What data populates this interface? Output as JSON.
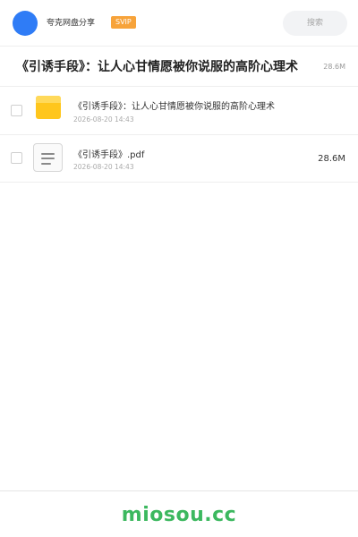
{
  "header": {
    "site_name": "夸克网盘分享",
    "badge": "SVIP",
    "search_placeholder": "搜索"
  },
  "share": {
    "title": "《引诱手段》：让人心甘情愿被你说服的高阶心理术",
    "total_size": "28.6M"
  },
  "files": [
    {
      "type": "folder",
      "icon": "folder-icon",
      "name": "《引诱手段》：让人心甘情愿被你说服的高阶心理术",
      "date": "2026-08-20 14:43",
      "size": ""
    },
    {
      "type": "pdf",
      "icon": "document-icon",
      "name": "《引诱手段》.pdf",
      "date": "2026-08-20 14:43",
      "size": "28.6M"
    }
  ],
  "footer": {
    "brand": "miosou.cc"
  },
  "colors": {
    "avatar": "#2f7cf6",
    "badge": "#f7a33a",
    "folder": "#ffc61c",
    "brand": "#3cb85f"
  }
}
